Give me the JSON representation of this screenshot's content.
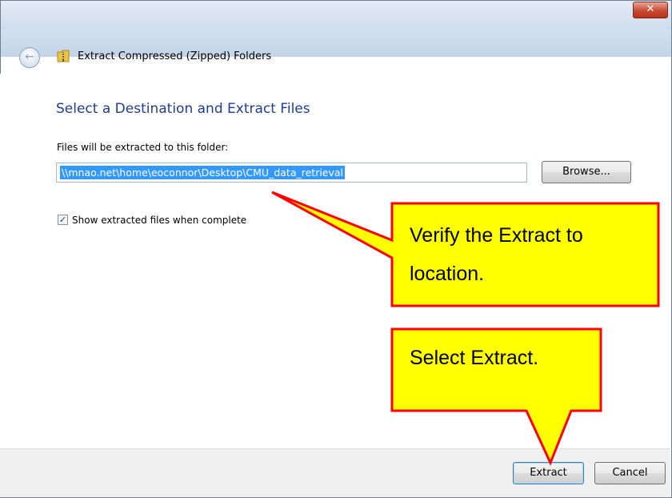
{
  "window": {
    "title": "Extract Compressed (Zipped) Folders",
    "close_glyph": "✕"
  },
  "main": {
    "heading": "Select a Destination and Extract Files",
    "path_label": "Files will be extracted to this folder:",
    "path_value": "\\\\mnao.net\\home\\eoconnor\\Desktop\\CMU_data_retrieval",
    "browse_label": "Browse...",
    "show_files_checkbox": {
      "label": "Show extracted files when complete",
      "checked": true
    }
  },
  "footer": {
    "extract_label": "Extract",
    "cancel_label": "Cancel"
  },
  "annotations": {
    "callout_1": "Verify the Extract to location.",
    "callout_2": "Select Extract.",
    "fill_color": "#ffff00",
    "border_color": "#ff0000"
  },
  "icons": {
    "back": "back-arrow-icon",
    "folder": "zip-folder-icon",
    "checkmark": "checkmark-icon"
  }
}
